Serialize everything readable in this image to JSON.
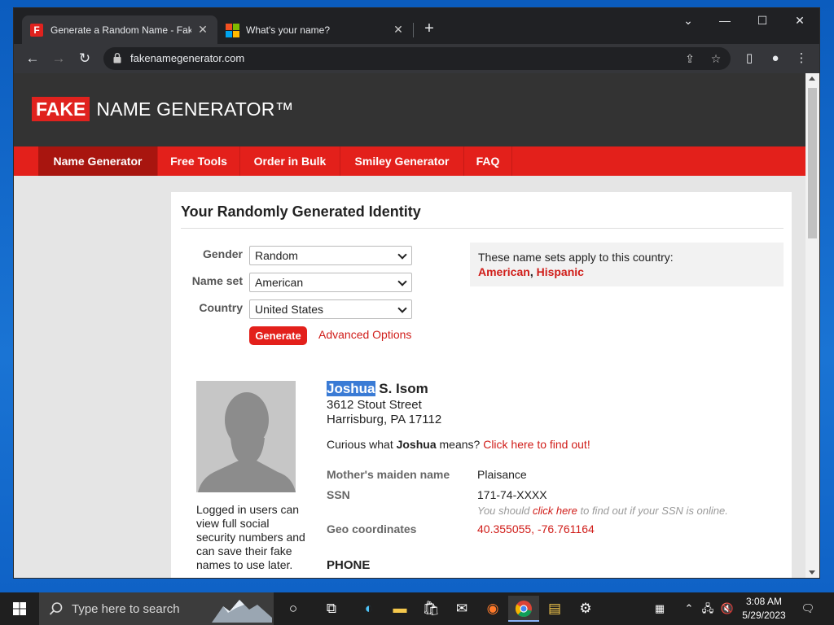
{
  "browser": {
    "tabs": [
      {
        "title": "Generate a Random Name - Fake Name Generator",
        "favicon": "F",
        "active": true
      },
      {
        "title": "What's your name?",
        "favicon": "microsoft-logo",
        "active": false
      }
    ],
    "new_tab": "+",
    "url": "fakenamegenerator.com",
    "window_controls": {
      "minimize": "—",
      "maximize": "☐",
      "close": "✕",
      "tab_search": "⌄"
    }
  },
  "site": {
    "logo_fake": "FAKE",
    "logo_rest": "NAME GENERATOR™",
    "nav": [
      "Name Generator",
      "Free Tools",
      "Order in Bulk",
      "Smiley Generator",
      "FAQ"
    ],
    "nav_active": "Name Generator"
  },
  "main": {
    "title": "Your Randomly Generated Identity",
    "form": {
      "gender_label": "Gender",
      "gender_value": "Random",
      "nameset_label": "Name set",
      "nameset_value": "American",
      "country_label": "Country",
      "country_value": "United States",
      "generate_label": "Generate",
      "advanced_label": "Advanced Options"
    },
    "nameset_info": {
      "text": "These name sets apply to this country:",
      "set1": "American",
      "separator": ", ",
      "set2": "Hispanic"
    },
    "identity": {
      "first_name_selected": "Joshua",
      "rest_name": " S. Isom",
      "address1": "3612 Stout Street",
      "address2": "Harrisburg, PA 17112",
      "curious_prefix": "Curious what ",
      "curious_name": "Joshua",
      "curious_mid": " means? ",
      "curious_link": "Click here to find out!",
      "login_note": "Logged in users can view full social security numbers and can save their fake names to use later.",
      "fields": [
        {
          "label": "Mother's maiden name",
          "value": "Plaisance"
        },
        {
          "label": "SSN",
          "value": "171-74-XXXX"
        },
        {
          "label": "Geo coordinates",
          "value": "40.355055, -76.761164"
        }
      ],
      "ssn_note_prefix": "You should ",
      "ssn_note_link": "click here",
      "ssn_note_suffix": " to find out if your SSN is online.",
      "phone_heading": "PHONE"
    }
  },
  "taskbar": {
    "search_placeholder": "Type here to search",
    "time": "3:08 AM",
    "date": "5/29/2023"
  },
  "colors": {
    "brand_red": "#e3201b",
    "nav_active": "#a8150f",
    "link_red": "#d01d19",
    "header_dark": "#333333"
  }
}
